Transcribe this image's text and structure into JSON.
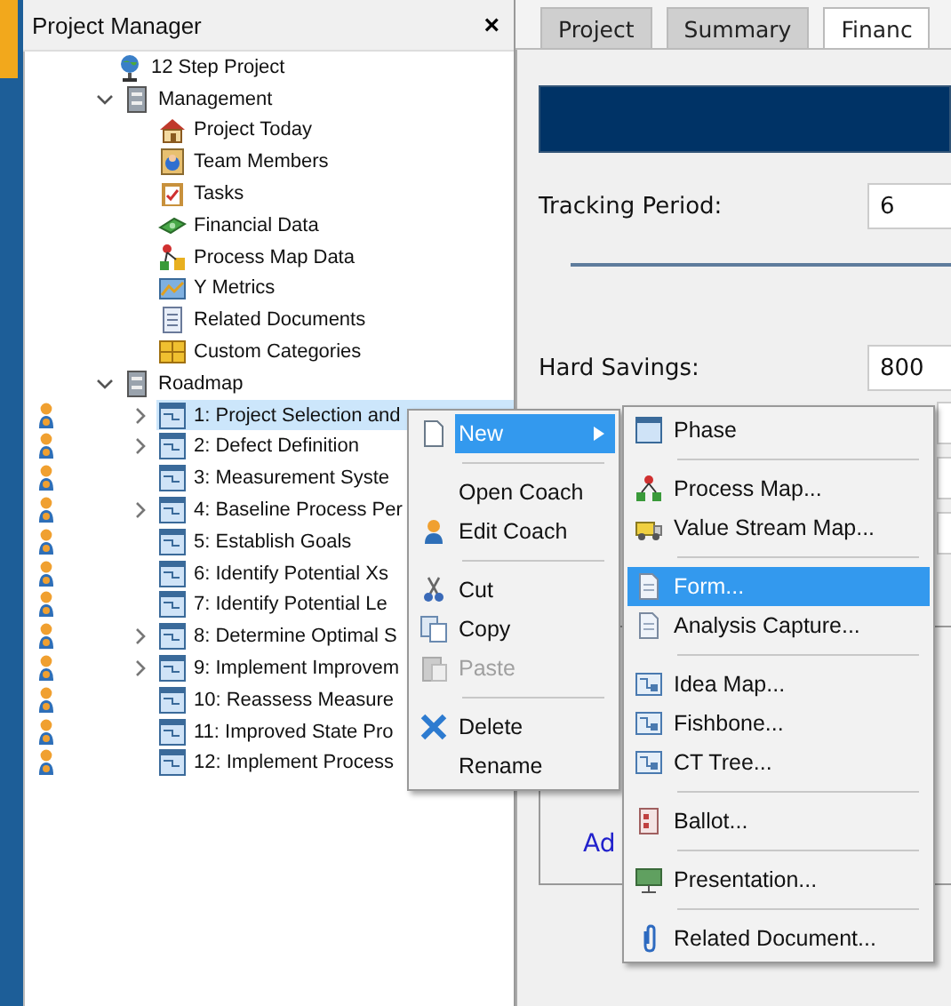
{
  "panel": {
    "title": "Project Manager",
    "close": "×"
  },
  "tree": {
    "label": "12 Step Project",
    "children": [
      {
        "label": "Management",
        "expanded": true,
        "children": [
          {
            "label": "Project Today"
          },
          {
            "label": "Team Members"
          },
          {
            "label": "Tasks"
          },
          {
            "label": "Financial Data"
          },
          {
            "label": "Process Map Data"
          },
          {
            "label": "Y Metrics"
          },
          {
            "label": "Related Documents"
          },
          {
            "label": "Custom Categories"
          }
        ]
      },
      {
        "label": "Roadmap",
        "expanded": true,
        "children": [
          {
            "label": "1: Project Selection and",
            "expandable": true,
            "selected": true,
            "coach": true
          },
          {
            "label": "2: Defect Definition",
            "expandable": true,
            "selected": false,
            "coach": true
          },
          {
            "label": "3: Measurement Syste",
            "expandable": false,
            "selected": false,
            "coach": true
          },
          {
            "label": "4: Baseline Process Per",
            "expandable": true,
            "selected": false,
            "coach": true
          },
          {
            "label": "5: Establish Goals",
            "expandable": false,
            "selected": false,
            "coach": true
          },
          {
            "label": "6: Identify Potential Xs",
            "expandable": false,
            "selected": false,
            "coach": true
          },
          {
            "label": "7: Identify Potential Le",
            "expandable": false,
            "selected": false,
            "coach": true
          },
          {
            "label": "8: Determine Optimal S",
            "expandable": true,
            "selected": false,
            "coach": true
          },
          {
            "label": "9: Implement Improvem",
            "expandable": true,
            "selected": false,
            "coach": true
          },
          {
            "label": "10: Reassess Measure",
            "expandable": false,
            "selected": false,
            "coach": true
          },
          {
            "label": "11: Improved State Pro",
            "expandable": false,
            "selected": false,
            "coach": true
          },
          {
            "label": "12: Implement Process",
            "expandable": false,
            "selected": false,
            "coach": true
          }
        ]
      }
    ]
  },
  "tabs": [
    {
      "label": "Project",
      "selected": false
    },
    {
      "label": "Summary",
      "selected": false
    },
    {
      "label": "Financ",
      "selected": true
    }
  ],
  "fields": [
    {
      "label": "Tracking Period:",
      "value": "6"
    },
    {
      "label": "Hard Savings:",
      "value": "800"
    }
  ],
  "link": "Ad",
  "context_menu": [
    {
      "kind": "item",
      "label": "New",
      "selected": true,
      "disabled": false,
      "submenu": true
    },
    {
      "kind": "separator"
    },
    {
      "kind": "item",
      "label": "Open Coach",
      "selected": false,
      "disabled": false,
      "submenu": false
    },
    {
      "kind": "item",
      "label": "Edit Coach",
      "selected": false,
      "disabled": false,
      "submenu": false
    },
    {
      "kind": "separator"
    },
    {
      "kind": "item",
      "label": "Cut",
      "selected": false,
      "disabled": false,
      "submenu": false
    },
    {
      "kind": "item",
      "label": "Copy",
      "selected": false,
      "disabled": false,
      "submenu": false
    },
    {
      "kind": "item",
      "label": "Paste",
      "selected": false,
      "disabled": true,
      "submenu": false
    },
    {
      "kind": "separator"
    },
    {
      "kind": "item",
      "label": "Delete",
      "selected": false,
      "disabled": false,
      "submenu": false
    },
    {
      "kind": "item",
      "label": "Rename",
      "selected": false,
      "disabled": false,
      "submenu": false
    }
  ],
  "submenu": [
    {
      "kind": "item",
      "label": "Phase",
      "selected": false
    },
    {
      "kind": "separator"
    },
    {
      "kind": "item",
      "label": "Process Map...",
      "selected": false
    },
    {
      "kind": "item",
      "label": "Value Stream Map...",
      "selected": false
    },
    {
      "kind": "separator"
    },
    {
      "kind": "item",
      "label": "Form...",
      "selected": true
    },
    {
      "kind": "item",
      "label": "Analysis Capture...",
      "selected": false
    },
    {
      "kind": "separator"
    },
    {
      "kind": "item",
      "label": "Idea Map...",
      "selected": false
    },
    {
      "kind": "item",
      "label": "Fishbone...",
      "selected": false
    },
    {
      "kind": "item",
      "label": "CT Tree...",
      "selected": false
    },
    {
      "kind": "separator"
    },
    {
      "kind": "item",
      "label": "Ballot...",
      "selected": false
    },
    {
      "kind": "separator"
    },
    {
      "kind": "item",
      "label": "Presentation...",
      "selected": false
    },
    {
      "kind": "separator"
    },
    {
      "kind": "item",
      "label": "Related Document...",
      "selected": false
    }
  ]
}
